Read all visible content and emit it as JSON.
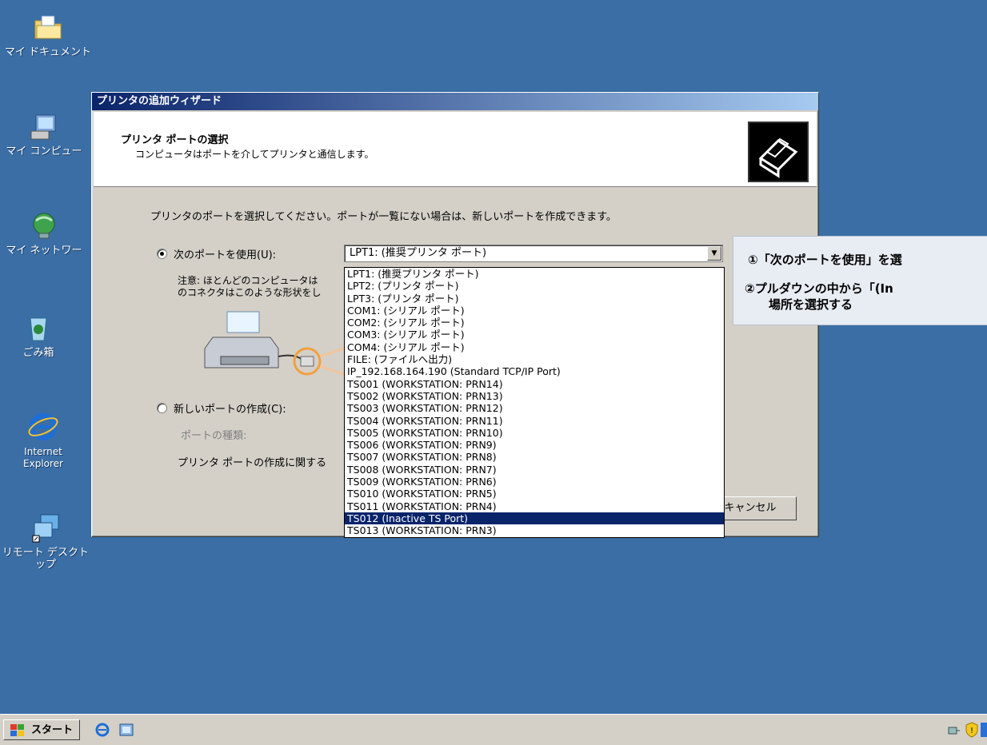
{
  "desktop": {
    "icons": [
      {
        "name": "mydocs",
        "label": "マイ ドキュメント"
      },
      {
        "name": "mycomputer",
        "label": "マイ コンピュー"
      },
      {
        "name": "mynetwork",
        "label": "マイ ネットワー"
      },
      {
        "name": "recyclebin",
        "label": "ごみ箱"
      },
      {
        "name": "ie",
        "label": "Internet Explorer"
      },
      {
        "name": "remotedesktop",
        "label": "リモート デスクトップ"
      }
    ]
  },
  "wizard": {
    "title": "プリンタの追加ウィザード",
    "header_title": "プリンタ ポートの選択",
    "header_subtitle": "コンピュータはポートを介してプリンタと通信します。",
    "instruction": "プリンタのポートを選択してください。ポートが一覧にない場合は、新しいポートを作成できます。",
    "use_port_label": "次のポートを使用(U):",
    "note_line1": "注意: ほとんどのコンピュータは",
    "note_line2": "のコネクタはこのような形状をし",
    "new_port_label": "新しいポートの作成(C):",
    "port_type_label": "ポートの種類:",
    "create_port_info": "プリンタ ポートの作成に関する",
    "cancel_label": "キャンセル",
    "combo_value": "LPT1: (推奨プリンタ ポート)",
    "dropdown_options": [
      "LPT1: (推奨プリンタ ポート)",
      "LPT2: (プリンタ ポート)",
      "LPT3: (プリンタ ポート)",
      "COM1: (シリアル ポート)",
      "COM2: (シリアル ポート)",
      "COM3: (シリアル ポート)",
      "COM4: (シリアル ポート)",
      "FILE: (ファイルへ出力)",
      "IP_192.168.164.190 (Standard TCP/IP Port)",
      "TS001 (WORKSTATION: PRN14)",
      "TS002 (WORKSTATION: PRN13)",
      "TS003 (WORKSTATION: PRN12)",
      "TS004 (WORKSTATION: PRN11)",
      "TS005 (WORKSTATION: PRN10)",
      "TS006 (WORKSTATION: PRN9)",
      "TS007 (WORKSTATION: PRN8)",
      "TS008 (WORKSTATION: PRN7)",
      "TS009 (WORKSTATION: PRN6)",
      "TS010 (WORKSTATION: PRN5)",
      "TS011 (WORKSTATION: PRN4)",
      "TS012 (Inactive TS Port)",
      "TS013 (WORKSTATION: PRN3)"
    ],
    "selected_option": "TS012 (Inactive TS Port)"
  },
  "annotation": {
    "line1": "①「次のポートを使用」を選",
    "line2": "②プルダウンの中から「(In",
    "line3": "場所を選択する"
  },
  "taskbar": {
    "start_label": "スタート"
  },
  "colors": {
    "desktop": "#3a6ea5",
    "titlebar": "#0a246a",
    "selection": "#0a246a"
  }
}
